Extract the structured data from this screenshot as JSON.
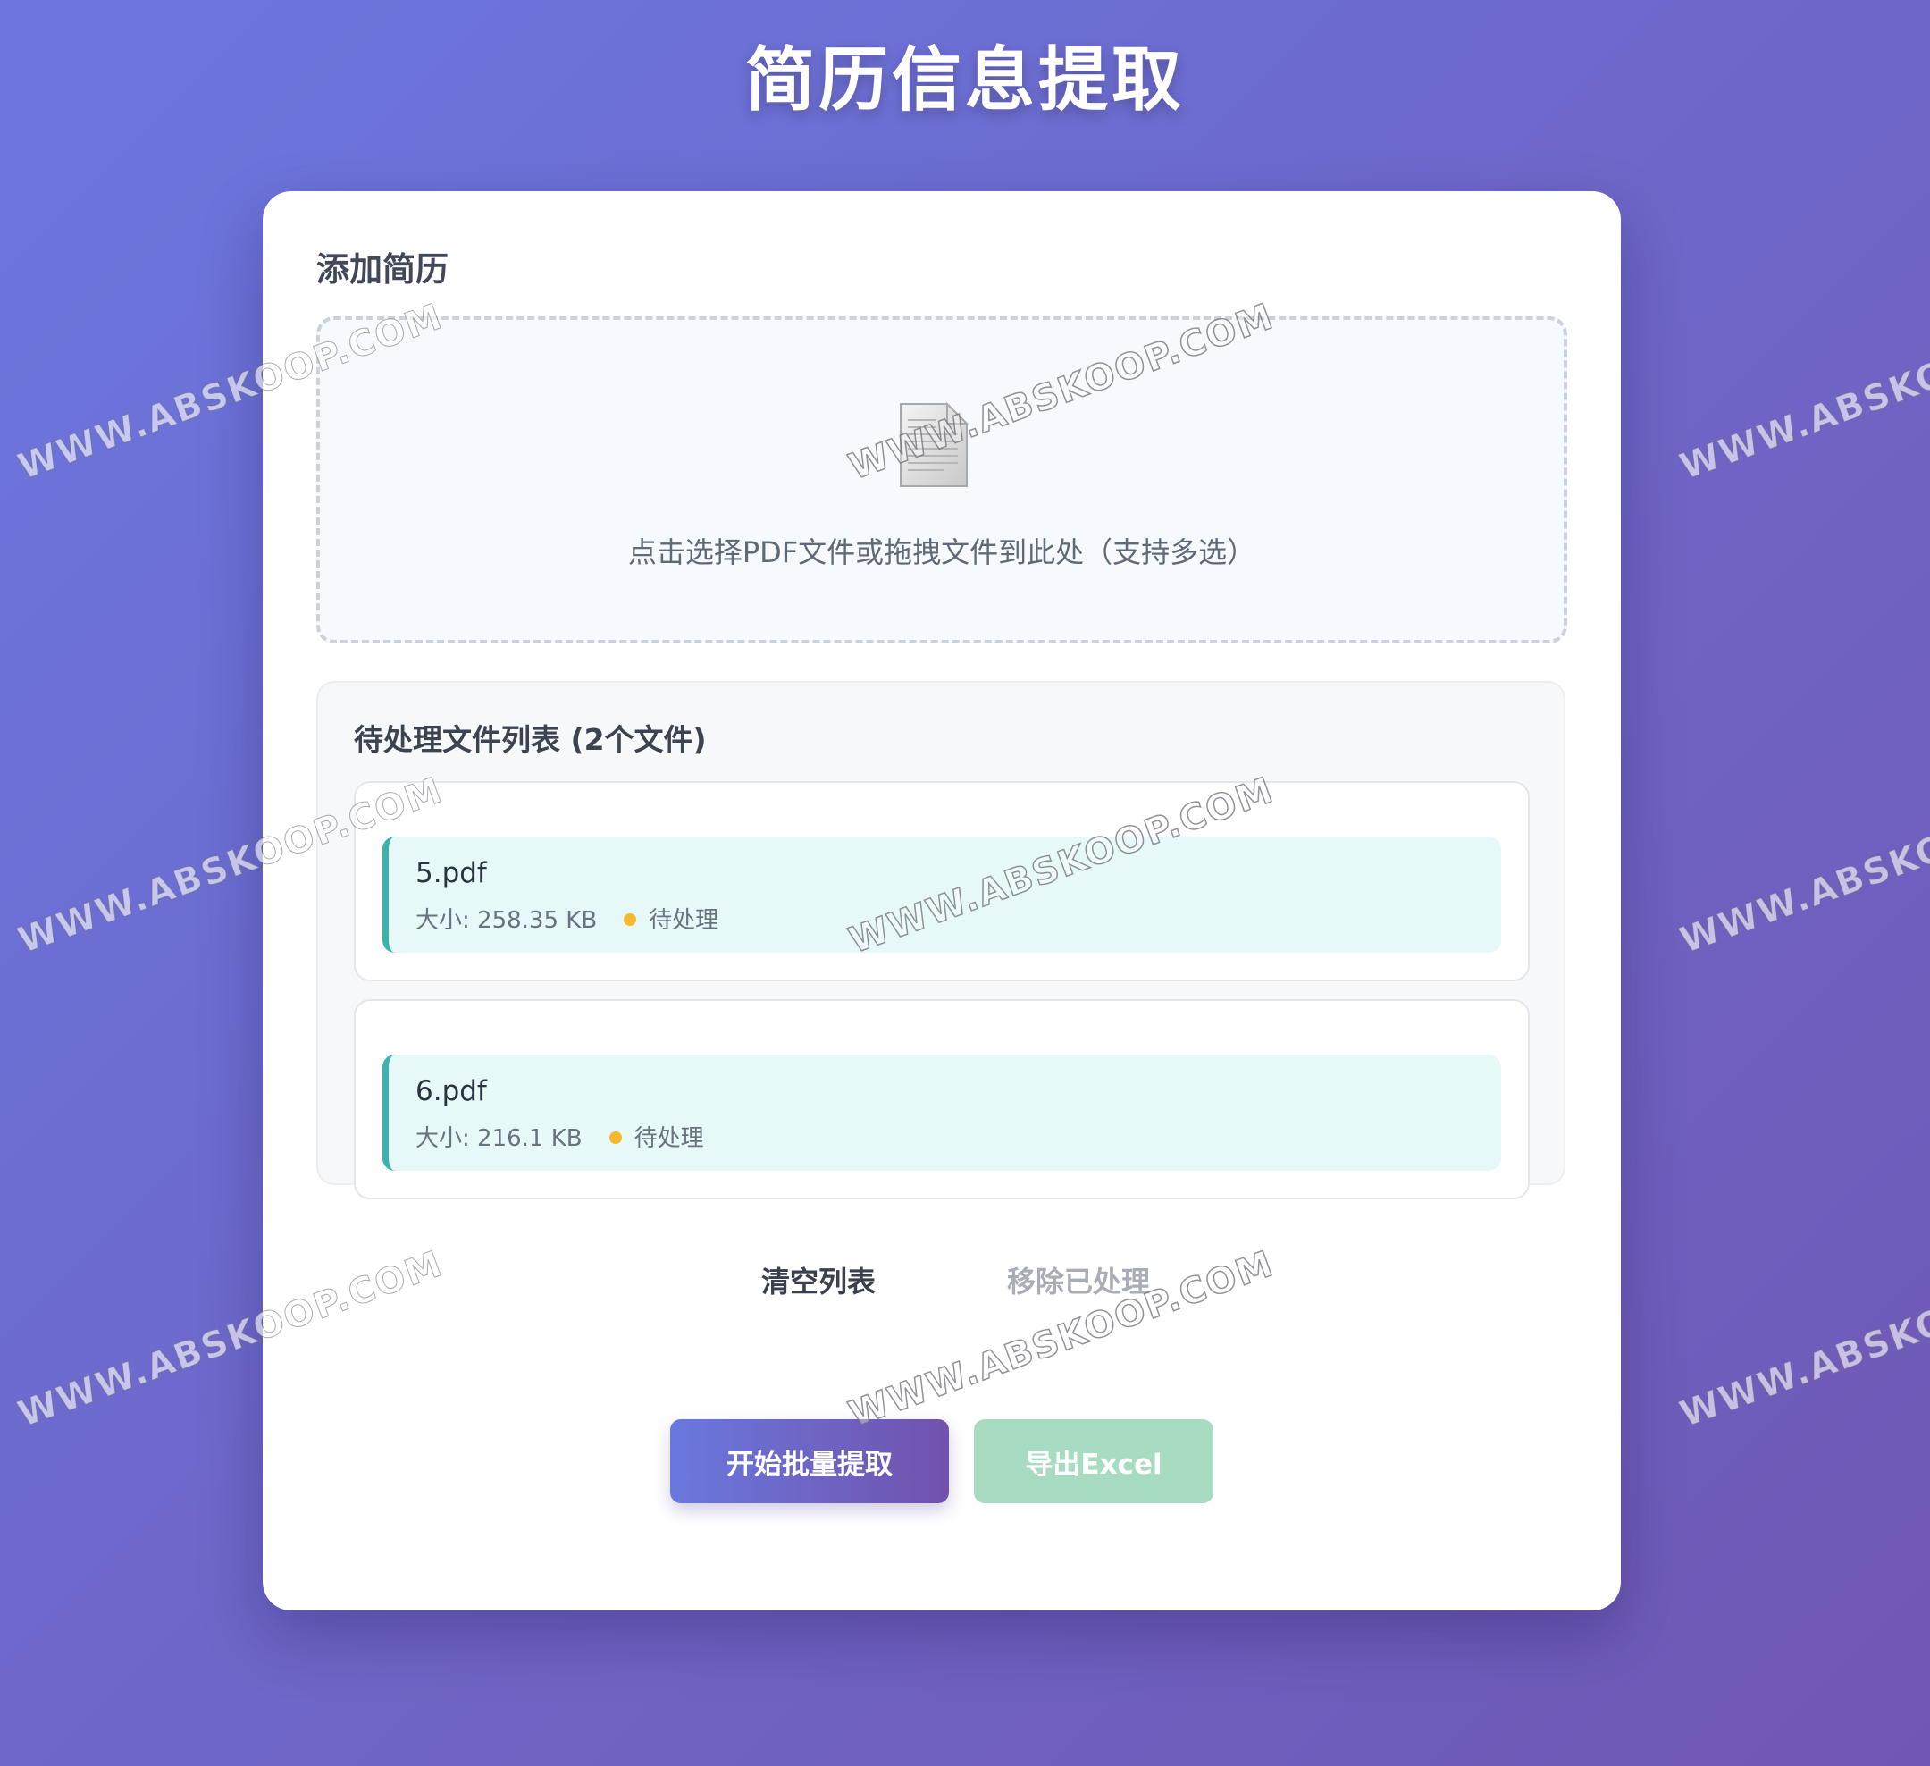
{
  "app": {
    "title": "简历信息提取"
  },
  "upload": {
    "section_title": "添加简历",
    "icon": "document-icon",
    "hint": "点击选择PDF文件或拖拽文件到此处（支持多选）"
  },
  "file_list": {
    "title": "待处理文件列表 (2个文件)",
    "files": [
      {
        "name": "5.pdf",
        "size_text": "大小: 258.35 KB",
        "status": "待处理",
        "status_color": "#f5b82e"
      },
      {
        "name": "6.pdf",
        "size_text": "大小: 216.1 KB",
        "status": "待处理",
        "status_color": "#f5b82e"
      }
    ],
    "clear_label": "清空列表",
    "remove_processed_label": "移除已处理"
  },
  "actions": {
    "start_label": "开始批量提取",
    "export_label": "导出Excel"
  },
  "watermark": {
    "text": "WWW.ABSKOOP.COM"
  },
  "colors": {
    "background_start": "#6b77df",
    "background_end": "#7157b4",
    "accent_teal": "#3ab3aa",
    "file_item_bg": "#e6f9f8",
    "export_disabled": "#a7dcc0",
    "status_pending": "#f5b82e"
  }
}
